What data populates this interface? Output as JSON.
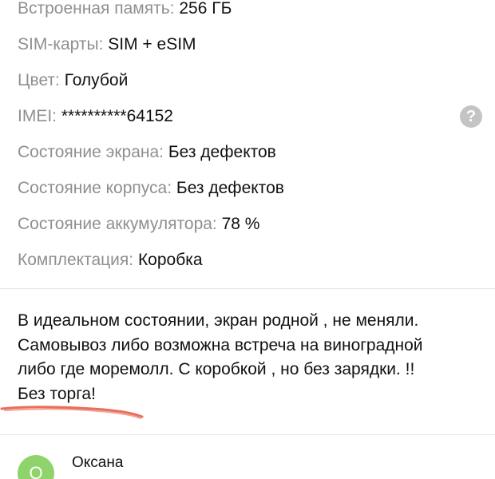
{
  "specs": [
    {
      "label": "Встроенная память:",
      "value": "256 ГБ"
    },
    {
      "label": "SIM-карты:",
      "value": "SIM + eSIM"
    },
    {
      "label": "Цвет:",
      "value": "Голубой"
    },
    {
      "label": "IMEI:",
      "value": "**********64152",
      "help_icon": "?"
    },
    {
      "label": "Состояние экрана:",
      "value": "Без дефектов"
    },
    {
      "label": "Состояние корпуса:",
      "value": "Без дефектов"
    },
    {
      "label": "Состояние аккумулятора:",
      "value": "78 %"
    },
    {
      "label": "Комплектация:",
      "value": "Коробка"
    }
  ],
  "description": {
    "lines": [
      "В идеальном состоянии, экран родной , не меняли.",
      "Самовывоз либо возможна встреча на виноградной",
      "либо где моремолл. С коробкой , но без зарядки. !!",
      "Без торга!"
    ]
  },
  "seller": {
    "name": "Оксана",
    "avatar_letter": "О"
  },
  "colors": {
    "label": "#8f8f8f",
    "value": "#111111",
    "avatar": "#8fd46a",
    "help_icon": "#c4c4c4",
    "annotation_stroke": "#e8553f"
  }
}
